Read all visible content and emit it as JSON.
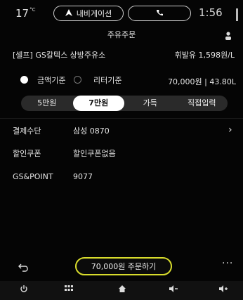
{
  "status_bar": {
    "temperature": "17",
    "temperature_unit": "°C",
    "nav_label": "내비게이션",
    "time": "1:56"
  },
  "header": {
    "title": "주유주문"
  },
  "station": {
    "name": "[셀프] GS칼텍스 상방주유소",
    "fuel_price": "휘발유 1,598원/L"
  },
  "mode": {
    "options": [
      "금액기준",
      "리터기준"
    ],
    "selected": "금액기준",
    "summary": "70,000원 | 43.80L"
  },
  "amount_options": {
    "items": [
      "5만원",
      "7만원",
      "가득",
      "직접입력"
    ],
    "selected_index": 1
  },
  "details": {
    "payment_label": "결제수단",
    "payment_value": "삼성 0870",
    "coupon_label": "할인쿠폰",
    "coupon_value": "할인쿠폰없음",
    "point_label": "GS&POINT",
    "point_value": "9077"
  },
  "actions": {
    "order_label": "70,000원 주문하기"
  },
  "icons": {
    "navigation": "navigation-arrow-icon",
    "phone": "phone-icon",
    "person": "person-icon",
    "back": "back-icon",
    "more": "more-icon",
    "power": "power-icon",
    "apps": "apps-grid-icon",
    "home": "home-icon",
    "volume_down": "volume-down-icon",
    "volume_up": "volume-up-icon"
  },
  "colors": {
    "accent": "#d8dc2c",
    "background": "#000000"
  }
}
